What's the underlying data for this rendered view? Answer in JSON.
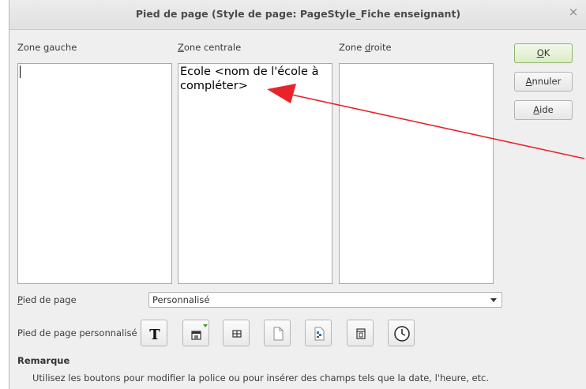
{
  "dialog": {
    "title": "Pied de page (Style de page: PageStyle_Fiche enseignant)",
    "close_symbol": "×"
  },
  "zones": {
    "left": {
      "label": "Zone gauche",
      "text": ""
    },
    "center": {
      "label": "Zone centrale",
      "text": "Ecole <nom de l'école à compléter>"
    },
    "right": {
      "label": "Zone droite",
      "text": ""
    }
  },
  "buttons": {
    "ok": "OK",
    "cancel": "Annuler",
    "help": "Aide"
  },
  "footer": {
    "label": "Pied de page",
    "selected": "Personnalisé",
    "custom_label": "Pied de page personnalisé"
  },
  "toolbar": {
    "text_attributes_symbol": "T",
    "icons": [
      "text-attributes-icon",
      "file-name-icon",
      "sheet-name-icon",
      "page-icon",
      "pages-icon",
      "date-icon",
      "time-icon"
    ]
  },
  "note": {
    "title": "Remarque",
    "text": "Utilisez les boutons pour modifier la police ou pour insérer des champs tels que la date, l'heure, etc."
  },
  "colors": {
    "annotation_arrow": "#e8232a",
    "ok_border": "#8fb46c"
  }
}
